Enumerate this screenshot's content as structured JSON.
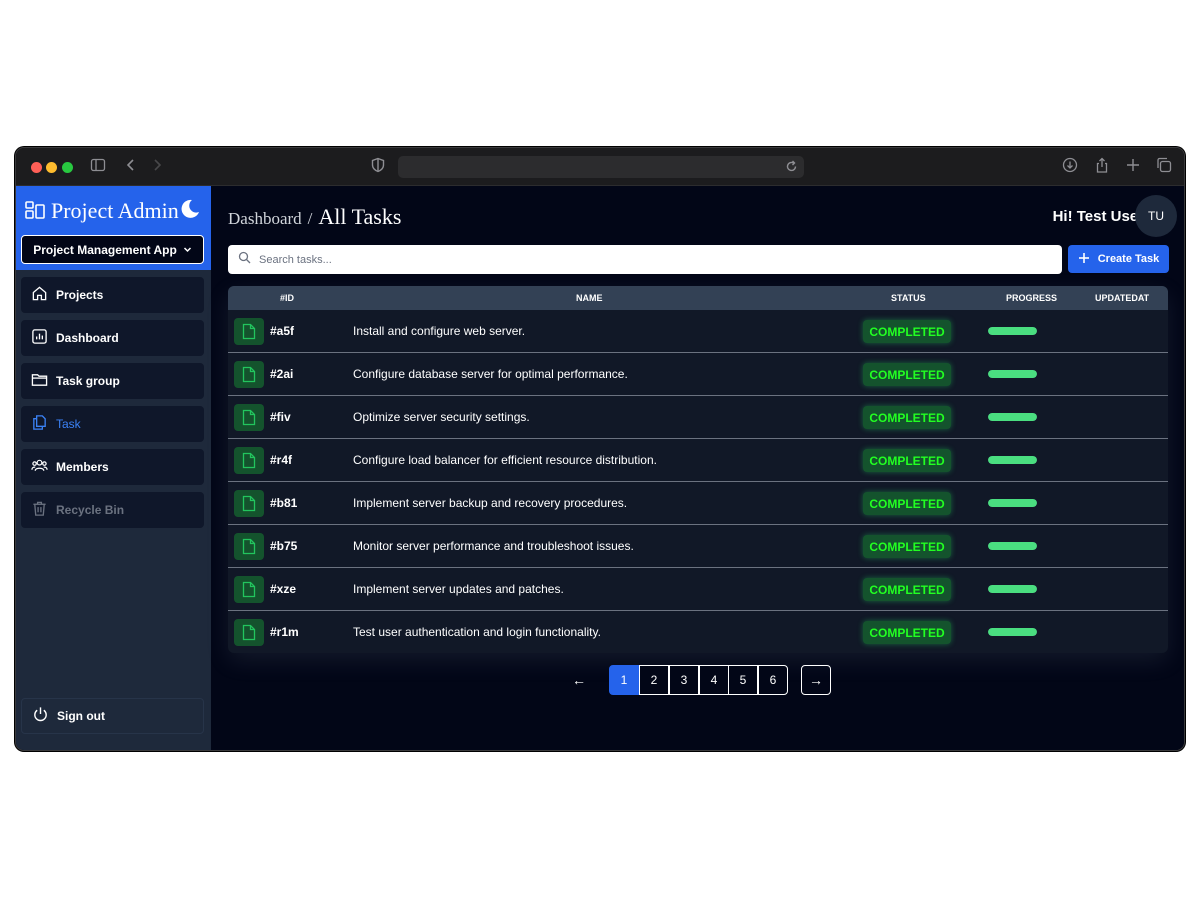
{
  "browser": {
    "icons": [
      "sidebar-toggle-icon",
      "back-icon",
      "forward-icon",
      "shield-icon",
      "reload-icon",
      "download-icon",
      "share-icon",
      "new-tab-icon",
      "tabs-overview-icon"
    ]
  },
  "sidebar": {
    "brand": "Project Admin",
    "project_select": "Project Management App",
    "items": [
      {
        "label": "Projects",
        "icon": "home-icon",
        "state": "normal"
      },
      {
        "label": "Dashboard",
        "icon": "chart-icon",
        "state": "normal"
      },
      {
        "label": "Task group",
        "icon": "folder-icon",
        "state": "normal"
      },
      {
        "label": "Task",
        "icon": "copy-icon",
        "state": "active"
      },
      {
        "label": "Members",
        "icon": "users-icon",
        "state": "normal"
      },
      {
        "label": "Recycle Bin",
        "icon": "trash-icon",
        "state": "disabled"
      }
    ],
    "signout": "Sign out"
  },
  "header": {
    "breadcrumb_parent": "Dashboard",
    "breadcrumb_sep": "/",
    "page_title": "All Tasks",
    "greeting": "Hi! Test User",
    "avatar_initials": "TU"
  },
  "toolbar": {
    "search_placeholder": "Search tasks...",
    "create_label": "Create Task"
  },
  "table": {
    "columns": [
      "#ID",
      "NAME",
      "STATUS",
      "PROGRESS",
      "UPDATEDAT"
    ],
    "rows": [
      {
        "id": "#a5f",
        "name": "Install and configure web server.",
        "status": "COMPLETED",
        "progress": 1.0,
        "updated": ""
      },
      {
        "id": "#2ai",
        "name": "Configure database server for optimal performance.",
        "status": "COMPLETED",
        "progress": 1.0,
        "updated": ""
      },
      {
        "id": "#fiv",
        "name": "Optimize server security settings.",
        "status": "COMPLETED",
        "progress": 1.0,
        "updated": ""
      },
      {
        "id": "#r4f",
        "name": "Configure load balancer for efficient resource distribution.",
        "status": "COMPLETED",
        "progress": 1.0,
        "updated": ""
      },
      {
        "id": "#b81",
        "name": "Implement server backup and recovery procedures.",
        "status": "COMPLETED",
        "progress": 1.0,
        "updated": ""
      },
      {
        "id": "#b75",
        "name": "Monitor server performance and troubleshoot issues.",
        "status": "COMPLETED",
        "progress": 1.0,
        "updated": ""
      },
      {
        "id": "#xze",
        "name": "Implement server updates and patches.",
        "status": "COMPLETED",
        "progress": 1.0,
        "updated": ""
      },
      {
        "id": "#r1m",
        "name": "Test user authentication and login functionality.",
        "status": "COMPLETED",
        "progress": 1.0,
        "updated": ""
      }
    ]
  },
  "pagination": {
    "prev": "←",
    "next": "→",
    "pages": [
      "1",
      "2",
      "3",
      "4",
      "5",
      "6"
    ],
    "current": "1"
  },
  "colors": {
    "accent": "#2563eb",
    "sidebar_bg": "#1e293b",
    "main_bg": "#020617",
    "status_green": "#22ff22",
    "progress_green": "#4ade80"
  }
}
